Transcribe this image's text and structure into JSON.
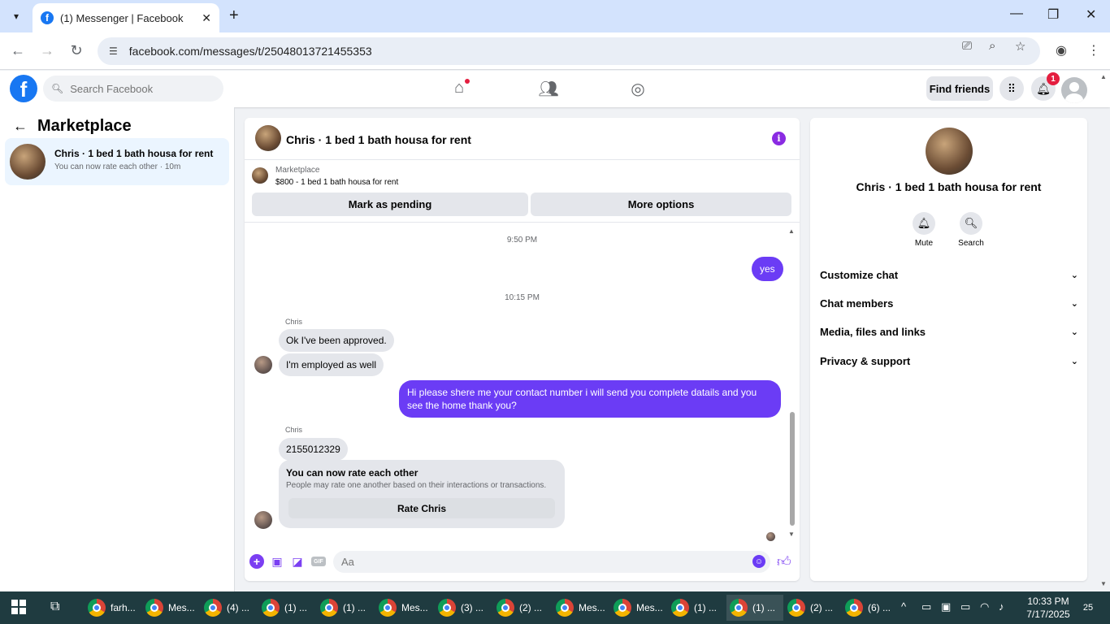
{
  "browser": {
    "tab_title": "(1) Messenger | Facebook",
    "url": "facebook.com/messages/t/25048013721455353"
  },
  "fb": {
    "search_placeholder": "Search Facebook",
    "find_friends": "Find friends",
    "notification_count": "1"
  },
  "left": {
    "title": "Marketplace",
    "conversation": {
      "name": "Chris · 1 bed 1 bath housa for rent",
      "preview": "You can now rate each other · 10m"
    }
  },
  "chat": {
    "title": "Chris · 1 bed 1 bath housa for rent",
    "listing_label": "Marketplace",
    "listing_price": "$800 - 1 bed 1 bath housa for rent",
    "mark_pending": "Mark as pending",
    "more_options": "More options",
    "messages": [
      {
        "type": "time",
        "text": "9:50 PM"
      },
      {
        "type": "out",
        "text": "yes"
      },
      {
        "type": "time",
        "text": "10:15 PM"
      },
      {
        "type": "sender",
        "text": "Chris"
      },
      {
        "type": "in",
        "text": "Ok I've been approved."
      },
      {
        "type": "in",
        "text": "I'm employed as well"
      },
      {
        "type": "out",
        "text": "Hi please shere me your contact number i will send you complete datails and you see the home thank you?"
      },
      {
        "type": "sender",
        "text": "Chris"
      },
      {
        "type": "in",
        "text": "2155012329"
      }
    ],
    "rate_title": "You can now rate each other",
    "rate_sub": "People may rate one another based on their interactions or transactions.",
    "rate_btn": "Rate Chris",
    "composer_placeholder": "Aa",
    "gif_label": "GIF"
  },
  "right": {
    "name": "Chris · 1 bed 1 bath housa for rent",
    "mute": "Mute",
    "search": "Search",
    "rows": [
      "Customize chat",
      "Chat members",
      "Media, files and links",
      "Privacy & support"
    ]
  },
  "taskbar": {
    "apps": [
      "farh...",
      "Mes...",
      "(4) ...",
      "(1) ...",
      "(1) ...",
      "Mes...",
      "(3) ...",
      "(2) ...",
      "Mes...",
      "Mes...",
      "(1) ...",
      "(1) ...",
      "(2) ...",
      "(6) ..."
    ],
    "time": "10:33 PM",
    "date": "7/17/2025",
    "notifications": "25"
  }
}
